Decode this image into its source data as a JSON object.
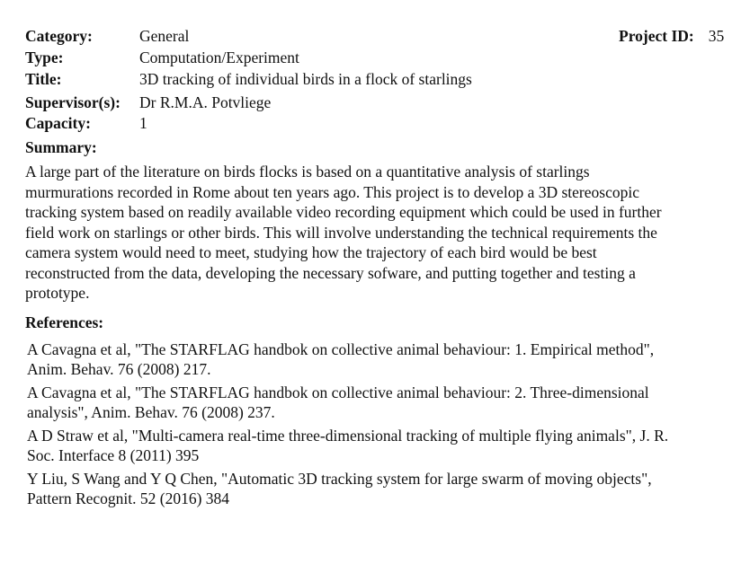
{
  "header": {
    "category_label": "Category:",
    "category_value": "General",
    "type_label": "Type:",
    "type_value": "Computation/Experiment",
    "title_label": "Title:",
    "title_value": "3D tracking of individual birds in a flock of starlings",
    "supervisor_label": "Supervisor(s):",
    "supervisor_value": "Dr R.M.A. Potvliege",
    "capacity_label": "Capacity:",
    "capacity_value": "1",
    "project_id_label": "Project ID:",
    "project_id_value": "35"
  },
  "summary": {
    "heading": "Summary:",
    "lines": [
      "A large part of the literature on birds flocks is based on a quantitative analysis of starlings",
      "murmurations recorded in Rome about ten years ago. This project is to develop a 3D stereoscopic",
      "tracking system based on readily available video recording equipment which could be used in further",
      "field work on starlings or other birds. This will involve understanding the technical requirements the",
      "camera system would need to meet, studying how the trajectory of each bird would be best",
      "reconstructed from the data, developing the necessary sofware, and putting together and testing a",
      "prototype."
    ]
  },
  "references": {
    "heading": "References:",
    "items": [
      {
        "lines": [
          "A Cavagna et al, \"The STARFLAG handbok on collective animal behaviour: 1. Empirical method\",",
          "Anim. Behav. 76 (2008) 217."
        ]
      },
      {
        "lines": [
          "A Cavagna et al, \"The STARFLAG handbok on collective animal behaviour: 2. Three-dimensional",
          "analysis\", Anim. Behav. 76 (2008) 237."
        ]
      },
      {
        "lines": [
          "A D Straw et al, \"Multi-camera real-time three-dimensional tracking of multiple flying animals\", J. R.",
          "Soc. Interface 8 (2011) 395"
        ]
      },
      {
        "lines": [
          "Y Liu, S Wang and Y Q Chen, \"Automatic 3D tracking system for large swarm of moving objects\",",
          "Pattern Recognit. 52 (2016) 384"
        ]
      }
    ]
  }
}
